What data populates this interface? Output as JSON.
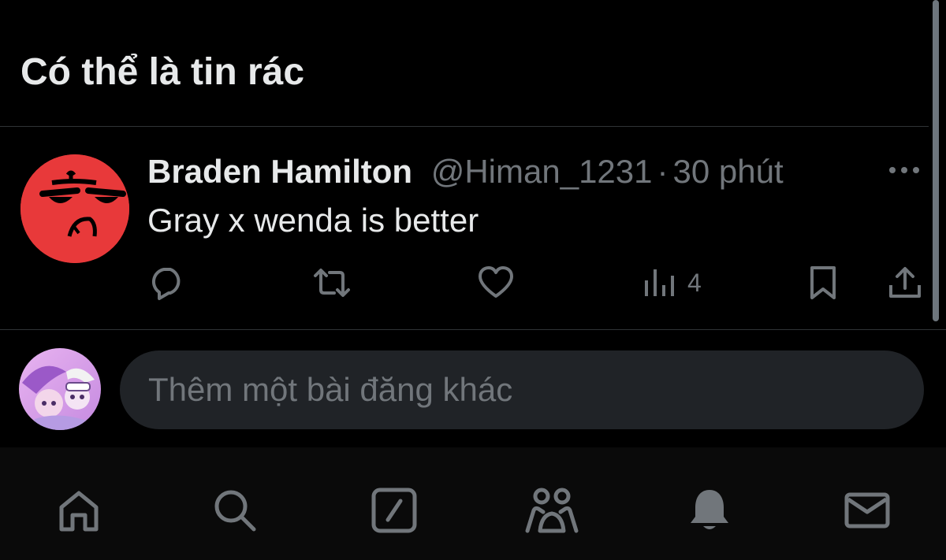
{
  "header": {
    "title": "Có thể là tin rác"
  },
  "tweet": {
    "author_name": "Braden Hamilton",
    "handle": "@Himan_1231",
    "separator": "·",
    "time": "30 phút",
    "text": "Gray x wenda is better",
    "views": "4",
    "avatar_color": "#e8393a",
    "icons": [
      "reply-icon",
      "retweet-icon",
      "like-icon",
      "views-icon",
      "bookmark-icon",
      "share-icon",
      "more-icon"
    ]
  },
  "reply": {
    "placeholder": "Thêm một bài đăng khác"
  },
  "tabbar": {
    "items": [
      "home-icon",
      "search-icon",
      "compose-icon",
      "communities-icon",
      "notifications-icon",
      "messages-icon"
    ]
  },
  "colors": {
    "background": "#000000",
    "text_primary": "#e7e9ea",
    "text_secondary": "#71767b",
    "divider": "#2f3336",
    "input_bg": "#202327"
  }
}
